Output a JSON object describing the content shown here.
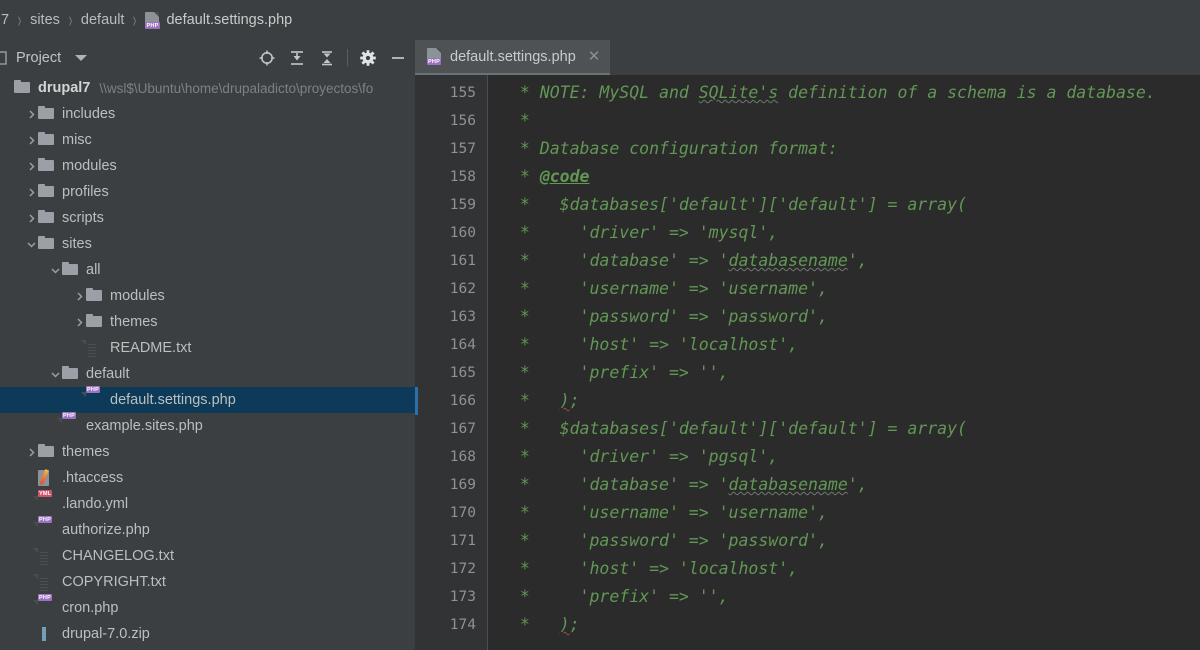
{
  "breadcrumb": {
    "items": [
      {
        "label": "7",
        "icon": null
      },
      {
        "label": "sites",
        "icon": null
      },
      {
        "label": "default",
        "icon": null
      },
      {
        "label": "default.settings.php",
        "icon": "php-file-icon"
      }
    ],
    "separator": "›"
  },
  "project_tool": {
    "title": "Project",
    "caret_icon": "chevron-down-icon",
    "icons": [
      {
        "name": "locate-target-icon",
        "tooltip": "Select Opened File"
      },
      {
        "name": "expand-all-icon",
        "tooltip": "Expand All"
      },
      {
        "name": "collapse-all-icon",
        "tooltip": "Collapse All"
      },
      {
        "name": "gear-icon",
        "tooltip": "Settings"
      },
      {
        "name": "hide-icon",
        "tooltip": "Hide"
      }
    ]
  },
  "tabs": [
    {
      "label": "default.settings.php",
      "icon": "php-file-icon",
      "active": true,
      "close_glyph": "✕"
    }
  ],
  "tree": {
    "root": {
      "label": "drupal7",
      "path": "\\\\wsl$\\Ubuntu\\home\\drupaladicto\\proyectos\\fo",
      "icon": "folder-icon",
      "bold": true,
      "indent": 0,
      "arrow": "none"
    },
    "items": [
      {
        "label": "includes",
        "icon": "folder-icon",
        "indent": 1,
        "arrow": "collapsed",
        "selected": false
      },
      {
        "label": "misc",
        "icon": "folder-icon",
        "indent": 1,
        "arrow": "collapsed",
        "selected": false
      },
      {
        "label": "modules",
        "icon": "folder-icon",
        "indent": 1,
        "arrow": "collapsed",
        "selected": false
      },
      {
        "label": "profiles",
        "icon": "folder-icon",
        "indent": 1,
        "arrow": "collapsed",
        "selected": false
      },
      {
        "label": "scripts",
        "icon": "folder-icon",
        "indent": 1,
        "arrow": "collapsed",
        "selected": false
      },
      {
        "label": "sites",
        "icon": "folder-icon",
        "indent": 1,
        "arrow": "expanded",
        "selected": false
      },
      {
        "label": "all",
        "icon": "folder-icon",
        "indent": 2,
        "arrow": "expanded",
        "selected": false
      },
      {
        "label": "modules",
        "icon": "folder-icon",
        "indent": 3,
        "arrow": "collapsed",
        "selected": false
      },
      {
        "label": "themes",
        "icon": "folder-icon",
        "indent": 3,
        "arrow": "collapsed",
        "selected": false
      },
      {
        "label": "README.txt",
        "icon": "text-file-icon",
        "indent": 3,
        "arrow": "none",
        "selected": false
      },
      {
        "label": "default",
        "icon": "folder-icon",
        "indent": 2,
        "arrow": "expanded",
        "selected": false
      },
      {
        "label": "default.settings.php",
        "icon": "php-file-icon",
        "indent": 3,
        "arrow": "none",
        "selected": true
      },
      {
        "label": "example.sites.php",
        "icon": "php-file-icon",
        "indent": 2,
        "arrow": "none",
        "selected": false
      },
      {
        "label": "themes",
        "icon": "folder-icon",
        "indent": 1,
        "arrow": "collapsed",
        "selected": false
      },
      {
        "label": ".htaccess",
        "icon": "htaccess-file-icon",
        "indent": 1,
        "arrow": "none",
        "selected": false
      },
      {
        "label": ".lando.yml",
        "icon": "yml-file-icon",
        "indent": 1,
        "arrow": "none",
        "selected": false
      },
      {
        "label": "authorize.php",
        "icon": "php-file-icon",
        "indent": 1,
        "arrow": "none",
        "selected": false
      },
      {
        "label": "CHANGELOG.txt",
        "icon": "text-file-icon",
        "indent": 1,
        "arrow": "none",
        "selected": false
      },
      {
        "label": "COPYRIGHT.txt",
        "icon": "text-file-icon",
        "indent": 1,
        "arrow": "none",
        "selected": false
      },
      {
        "label": "cron.php",
        "icon": "php-file-icon",
        "indent": 1,
        "arrow": "none",
        "selected": false
      },
      {
        "label": "drupal-7.0.zip",
        "icon": "zip-file-icon",
        "indent": 1,
        "arrow": "none",
        "selected": false
      }
    ],
    "arrow_glyphs": {
      "collapsed": "›",
      "expanded": "⌄"
    }
  },
  "editor": {
    "first_line_number": 155,
    "lines": [
      {
        "n": 155,
        "text": " * NOTE: MySQL and SQLite's definition of a schema is a database."
      },
      {
        "n": 156,
        "text": " *"
      },
      {
        "n": 157,
        "text": " * Database configuration format:"
      },
      {
        "n": 158,
        "text": " * @code"
      },
      {
        "n": 159,
        "text": " *   $databases['default']['default'] = array("
      },
      {
        "n": 160,
        "text": " *     'driver' => 'mysql',"
      },
      {
        "n": 161,
        "text": " *     'database' => 'databasename',"
      },
      {
        "n": 162,
        "text": " *     'username' => 'username',"
      },
      {
        "n": 163,
        "text": " *     'password' => 'password',"
      },
      {
        "n": 164,
        "text": " *     'host' => 'localhost',"
      },
      {
        "n": 165,
        "text": " *     'prefix' => '',"
      },
      {
        "n": 166,
        "text": " *   );"
      },
      {
        "n": 167,
        "text": " *   $databases['default']['default'] = array("
      },
      {
        "n": 168,
        "text": " *     'driver' => 'pgsql',"
      },
      {
        "n": 169,
        "text": " *     'database' => 'databasename',"
      },
      {
        "n": 170,
        "text": " *     'username' => 'username',"
      },
      {
        "n": 171,
        "text": " *     'password' => 'password',"
      },
      {
        "n": 172,
        "text": " *     'host' => 'localhost',"
      },
      {
        "n": 173,
        "text": " *     'prefix' => '',"
      },
      {
        "n": 174,
        "text": " *   );"
      }
    ],
    "doc_tag": "@code",
    "doc_tag_line": 158
  },
  "colors": {
    "window_bg": "#3c3f41",
    "editor_bg": "#2b2b2b",
    "gutter_bg": "#313335",
    "selection_bg": "#0d3a58",
    "comment_green": "#629755",
    "tab_active_bg": "#4e5254",
    "tab_underline": "#6a7377",
    "php_badge": "#9b72c0",
    "yml_badge": "#d0536a"
  }
}
